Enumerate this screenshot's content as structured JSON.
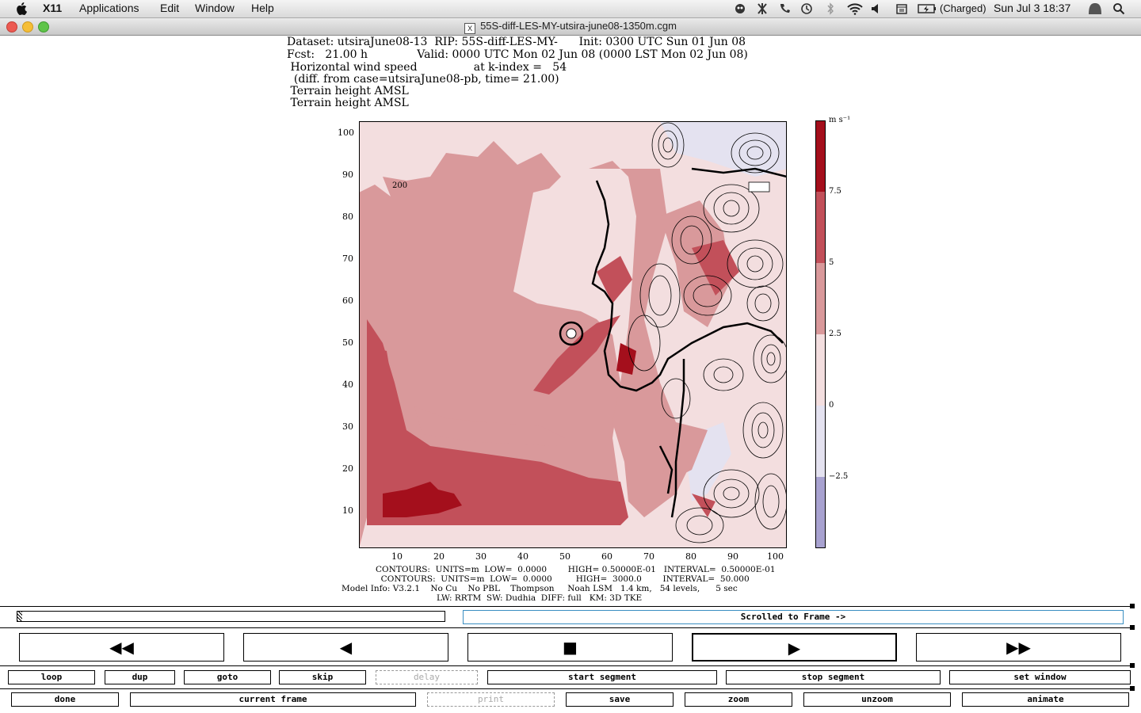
{
  "menubar": {
    "app": "X11",
    "items": [
      "Applications",
      "Edit",
      "Window",
      "Help"
    ],
    "battery": "(Charged)",
    "clock": "Sun Jul 3  18:37"
  },
  "window": {
    "title": "55S-diff-LES-MY-utsira-june08-1350m.cgm"
  },
  "plot": {
    "header_lines": [
      "Dataset: utsiraJune08-13  RIP: 55S-diff-LES-MY-      Init: 0300 UTC Sun 01 Jun 08",
      "Fcst:   21.00 h              Valid: 0000 UTC Mon 02 Jun 08 (0000 LST Mon 02 Jun 08)",
      " Horizontal wind speed                at k-index =   54",
      "  (diff. from case=utsiraJune08-pb, time= 21.00)",
      " Terrain height AMSL",
      " Terrain height AMSL"
    ],
    "y_ticks": [
      "100",
      "90",
      "80",
      "70",
      "60",
      "50",
      "40",
      "30",
      "20",
      "10"
    ],
    "x_ticks": [
      "10",
      "20",
      "30",
      "40",
      "50",
      "60",
      "70",
      "80",
      "90",
      "100"
    ],
    "contour_label": "200",
    "legend": {
      "unit": "m s⁻¹",
      "ticks": [
        "7.5",
        "5",
        "2.5",
        "0",
        "−2.5"
      ],
      "colors": [
        "#a40f1c",
        "#c2505a",
        "#d9999b",
        "#f3dedf",
        "#e4e2f0",
        "#a8a2d0"
      ]
    },
    "footer_lines": [
      "CONTOURS:  UNITS=m  LOW=  0.0000        HIGH= 0.50000E-01   INTERVAL=  0.50000E-01",
      "  CONTOURS:  UNITS=m  LOW=  0.0000         HIGH=  3000.0        INTERVAL=  50.000",
      "Model Info: V3.2.1    No Cu    No PBL    Thompson     Noah LSM   1.4 km,   54 levels,      5 sec",
      "LW: RRTM  SW: Dudhia  DIFF: full   KM: 3D TKE"
    ]
  },
  "controls": {
    "status_text": "Scrolled to Frame ->",
    "transport": [
      "◀◀",
      "◀",
      "■",
      "▶",
      "▶▶"
    ],
    "row1": [
      "loop",
      "dup",
      "goto",
      "skip",
      "delay",
      "start segment",
      "stop segment",
      "set window"
    ],
    "row2": [
      "done",
      "current frame",
      "print",
      "save",
      "zoom",
      "unzoom",
      "animate"
    ]
  }
}
